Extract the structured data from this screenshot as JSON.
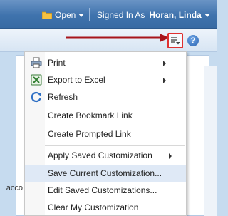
{
  "header": {
    "open_label": "Open",
    "signed_in_label": "Signed In As",
    "user_name": "Horan, Linda"
  },
  "toolbar": {
    "page_options_icon": "page-options-icon",
    "help_label": "?"
  },
  "background": {
    "fragment_text": "acco"
  },
  "menu": {
    "items": [
      {
        "label": "Print",
        "icon": "printer-icon",
        "submenu": true
      },
      {
        "label": "Export to Excel",
        "icon": "excel-icon",
        "submenu": true
      },
      {
        "label": "Refresh",
        "icon": "refresh-icon",
        "submenu": false
      },
      {
        "label": "Create Bookmark Link",
        "icon": "",
        "submenu": false
      },
      {
        "label": "Create Prompted Link",
        "icon": "",
        "submenu": false
      },
      {
        "label": "Apply Saved Customization",
        "icon": "",
        "submenu": true
      },
      {
        "label": "Save Current Customization...",
        "icon": "",
        "submenu": false,
        "highlighted": true
      },
      {
        "label": "Edit Saved Customizations...",
        "icon": "",
        "submenu": false
      },
      {
        "label": "Clear My Customization",
        "icon": "",
        "submenu": false
      }
    ]
  },
  "colors": {
    "header_blue": "#3f73ad",
    "highlight": "#dfe9f6",
    "annotation_red": "#e03030"
  }
}
